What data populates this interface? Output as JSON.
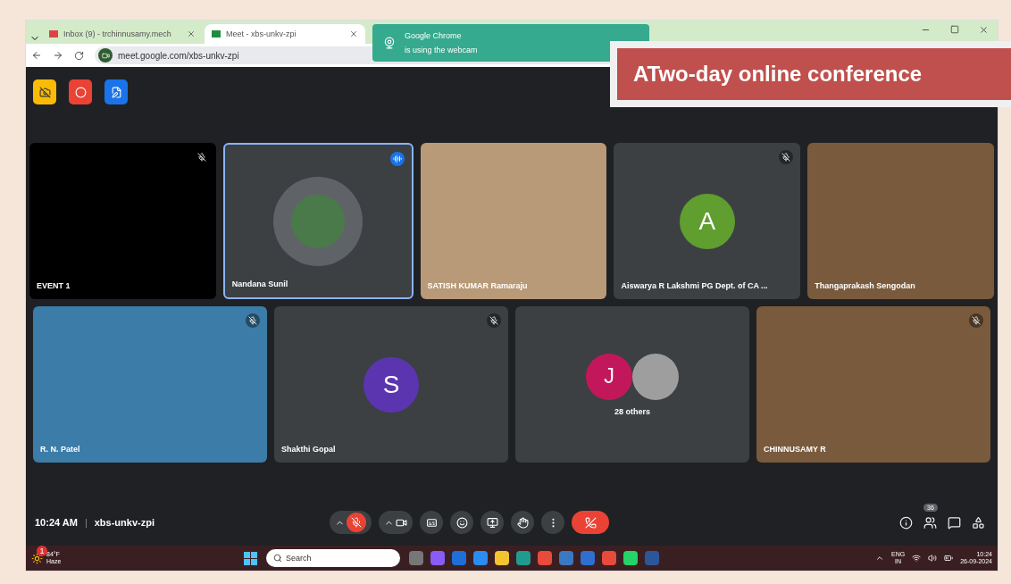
{
  "browser": {
    "tabs": [
      {
        "title": "Inbox (9) - trchinnusamy.mech",
        "kind": "mail",
        "selected": false
      },
      {
        "title": "Meet - xbs-unkv-zpi",
        "kind": "meet",
        "selected": true
      }
    ],
    "url": "meet.google.com/xbs-unkv-zpi"
  },
  "notification": {
    "title": "Google Chrome",
    "subtitle": "is using the webcam"
  },
  "banner": {
    "text": "ATwo-day online conference"
  },
  "meet": {
    "indicators": [
      {
        "kind": "camera_off"
      },
      {
        "kind": "recording"
      },
      {
        "kind": "notes"
      }
    ],
    "tiles": [
      {
        "name": "EVENT 1",
        "kind": "blank",
        "muted": true,
        "speaking": false
      },
      {
        "name": "Nandana Sunil",
        "kind": "photo",
        "muted": false,
        "speaking": true
      },
      {
        "name": "SATISH KUMAR Ramaraju",
        "kind": "video",
        "muted": false,
        "speaking": false
      },
      {
        "name": "Aiswarya R Lakshmi PG Dept. of CA ...",
        "kind": "avatar",
        "initial": "A",
        "color": "#5f9e2f",
        "muted": true,
        "speaking": false
      },
      {
        "name": "Thangaprakash Sengodan",
        "kind": "video",
        "muted": false,
        "speaking": false
      },
      {
        "name": "R. N. Patel",
        "kind": "video",
        "muted": true,
        "speaking": false
      },
      {
        "name": "Shakthi Gopal",
        "kind": "avatar",
        "initial": "S",
        "color": "#5b35b0",
        "muted": true,
        "speaking": false
      },
      {
        "name": "28 others",
        "kind": "group",
        "initial": "J",
        "color": "#c2185b",
        "muted": false,
        "speaking": false
      },
      {
        "name": "CHINNUSAMY R",
        "kind": "video",
        "muted": true,
        "speaking": false
      }
    ],
    "time": "10:24 AM",
    "separator": "|",
    "code": "xbs-unkv-zpi",
    "controls": [
      {
        "kind": "mic",
        "on": false
      },
      {
        "kind": "camera",
        "on": true
      },
      {
        "kind": "captions"
      },
      {
        "kind": "emoji"
      },
      {
        "kind": "present"
      },
      {
        "kind": "hand"
      },
      {
        "kind": "more"
      },
      {
        "kind": "leave"
      }
    ],
    "side": [
      {
        "kind": "info"
      },
      {
        "kind": "people",
        "badge": "36"
      },
      {
        "kind": "chat"
      },
      {
        "kind": "activities"
      }
    ]
  },
  "taskbar": {
    "temp": "84°F",
    "condition": "Haze",
    "weather_badge": "1",
    "search": "Search",
    "apps": [
      {
        "kind": "files"
      },
      {
        "kind": "copilot"
      },
      {
        "kind": "store"
      },
      {
        "kind": "help"
      },
      {
        "kind": "explorer"
      },
      {
        "kind": "edge"
      },
      {
        "kind": "chrome"
      },
      {
        "kind": "calc"
      },
      {
        "kind": "tool"
      },
      {
        "kind": "chrome"
      },
      {
        "kind": "whatsapp"
      },
      {
        "kind": "word"
      }
    ],
    "lang": "ENG",
    "region": "IN",
    "clock": "10:24",
    "date": "26-09-2024"
  }
}
